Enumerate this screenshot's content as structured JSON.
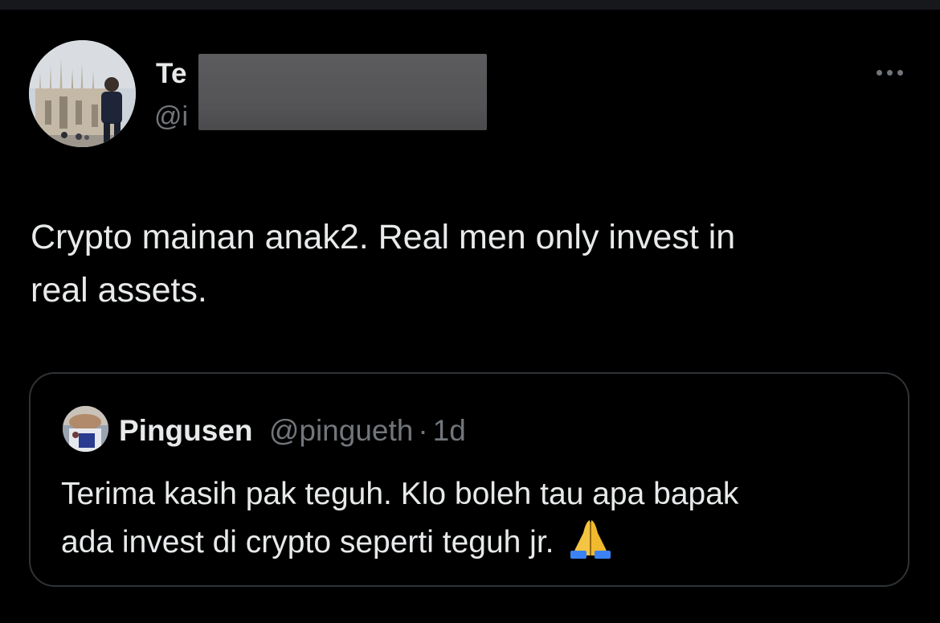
{
  "author": {
    "display_name": "Te",
    "handle": "@i",
    "avatar_icon": "profile-photo"
  },
  "tweet": {
    "text_line1": "Crypto mainan anak2. Real men only invest in",
    "text_line2": "real assets."
  },
  "quoted_tweet": {
    "display_name": "Pingusen",
    "handle": "@pingueth",
    "separator": "·",
    "time": "1d",
    "text_line1": "Terima kasih pak teguh. Klo boleh tau apa bapak",
    "text_line2": "ada invest di crypto seperti teguh jr.",
    "emoji_icon": "folded-hands-emoji"
  },
  "colors": {
    "background": "#000000",
    "text": "#e7e9ea",
    "secondary_text": "#71767b",
    "border": "#2f3336",
    "redaction": "#58585a"
  }
}
